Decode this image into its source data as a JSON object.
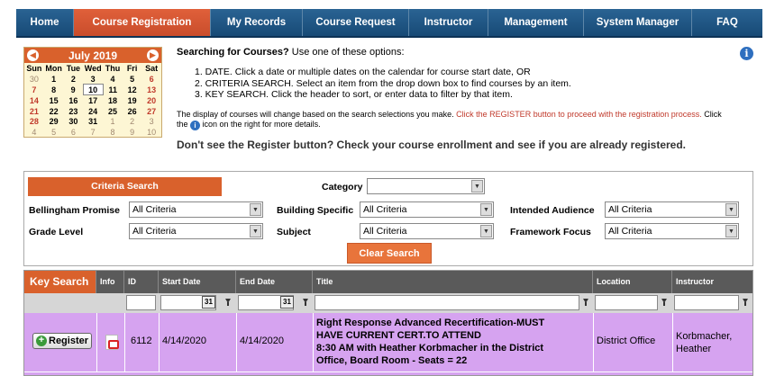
{
  "nav": [
    {
      "label": "Home"
    },
    {
      "label": "Course Registration",
      "active": true
    },
    {
      "label": "My Records"
    },
    {
      "label": "Course Request"
    },
    {
      "label": "Instructor"
    },
    {
      "label": "Management"
    },
    {
      "label": "System Manager"
    },
    {
      "label": "FAQ"
    }
  ],
  "calendar": {
    "title": "July 2019",
    "days": [
      "Sun",
      "Mon",
      "Tue",
      "Wed",
      "Thu",
      "Fri",
      "Sat"
    ],
    "weeks": [
      [
        "30",
        "1",
        "2",
        "3",
        "4",
        "5",
        "6"
      ],
      [
        "7",
        "8",
        "9",
        "10",
        "11",
        "12",
        "13"
      ],
      [
        "14",
        "15",
        "16",
        "17",
        "18",
        "19",
        "20"
      ],
      [
        "21",
        "22",
        "23",
        "24",
        "25",
        "26",
        "27"
      ],
      [
        "28",
        "29",
        "30",
        "31",
        "1",
        "2",
        "3"
      ],
      [
        "4",
        "5",
        "6",
        "7",
        "8",
        "9",
        "10"
      ]
    ]
  },
  "intro": {
    "lead_bold": "Searching for Courses?",
    "lead_rest": " Use one of these options:",
    "steps": [
      "1. DATE. Click a date or multiple dates on the calendar for course start date, OR",
      "2. CRITERIA SEARCH. Select an item from the drop down box to find courses by an item.",
      "3. KEY SEARCH.  Click the header to sort, or enter data to filter by that item."
    ],
    "note_a": "The display of courses will change based on the search selections you make. ",
    "note_red": "Click the REGISTER button to proceed with the registration process.",
    "note_b": " Click the ",
    "note_c": " icon on the right for more details.",
    "notice": "Don't see the Register button? Check your course enrollment and see if you are already registered."
  },
  "criteria": {
    "header": "Criteria Search",
    "category_label": "Category",
    "category_value": "",
    "fields": [
      {
        "label": "Bellingham Promise",
        "value": "All Criteria"
      },
      {
        "label": "Building Specific",
        "value": "All Criteria"
      },
      {
        "label": "Intended Audience",
        "value": "All Criteria"
      },
      {
        "label": "Grade Level",
        "value": "All Criteria"
      },
      {
        "label": "Subject",
        "value": "All Criteria"
      },
      {
        "label": "Framework Focus",
        "value": "All Criteria"
      }
    ],
    "clear_label": "Clear Search"
  },
  "table": {
    "headers": [
      "Key Search",
      "Info",
      "ID",
      "Start Date",
      "End Date",
      "Title",
      "Location",
      "Instructor"
    ],
    "calendar_icon_text": "31",
    "row": {
      "register_label": "Register",
      "id": "6112",
      "start": "4/14/2020",
      "end": "4/14/2020",
      "title_lines": [
        "Right Response Advanced Recertification-MUST",
        "HAVE CURRENT CERT.TO ATTEND",
        "8:30 AM with Heather Korbmacher in the District",
        "Office, Board Room - Seats = 22"
      ],
      "location": "District Office",
      "instructor_lines": [
        "Korbmacher,",
        "Heather"
      ]
    }
  },
  "colors": {
    "nav": "#1a5180",
    "accent": "#d9612c",
    "row": "#d6a3f0"
  }
}
